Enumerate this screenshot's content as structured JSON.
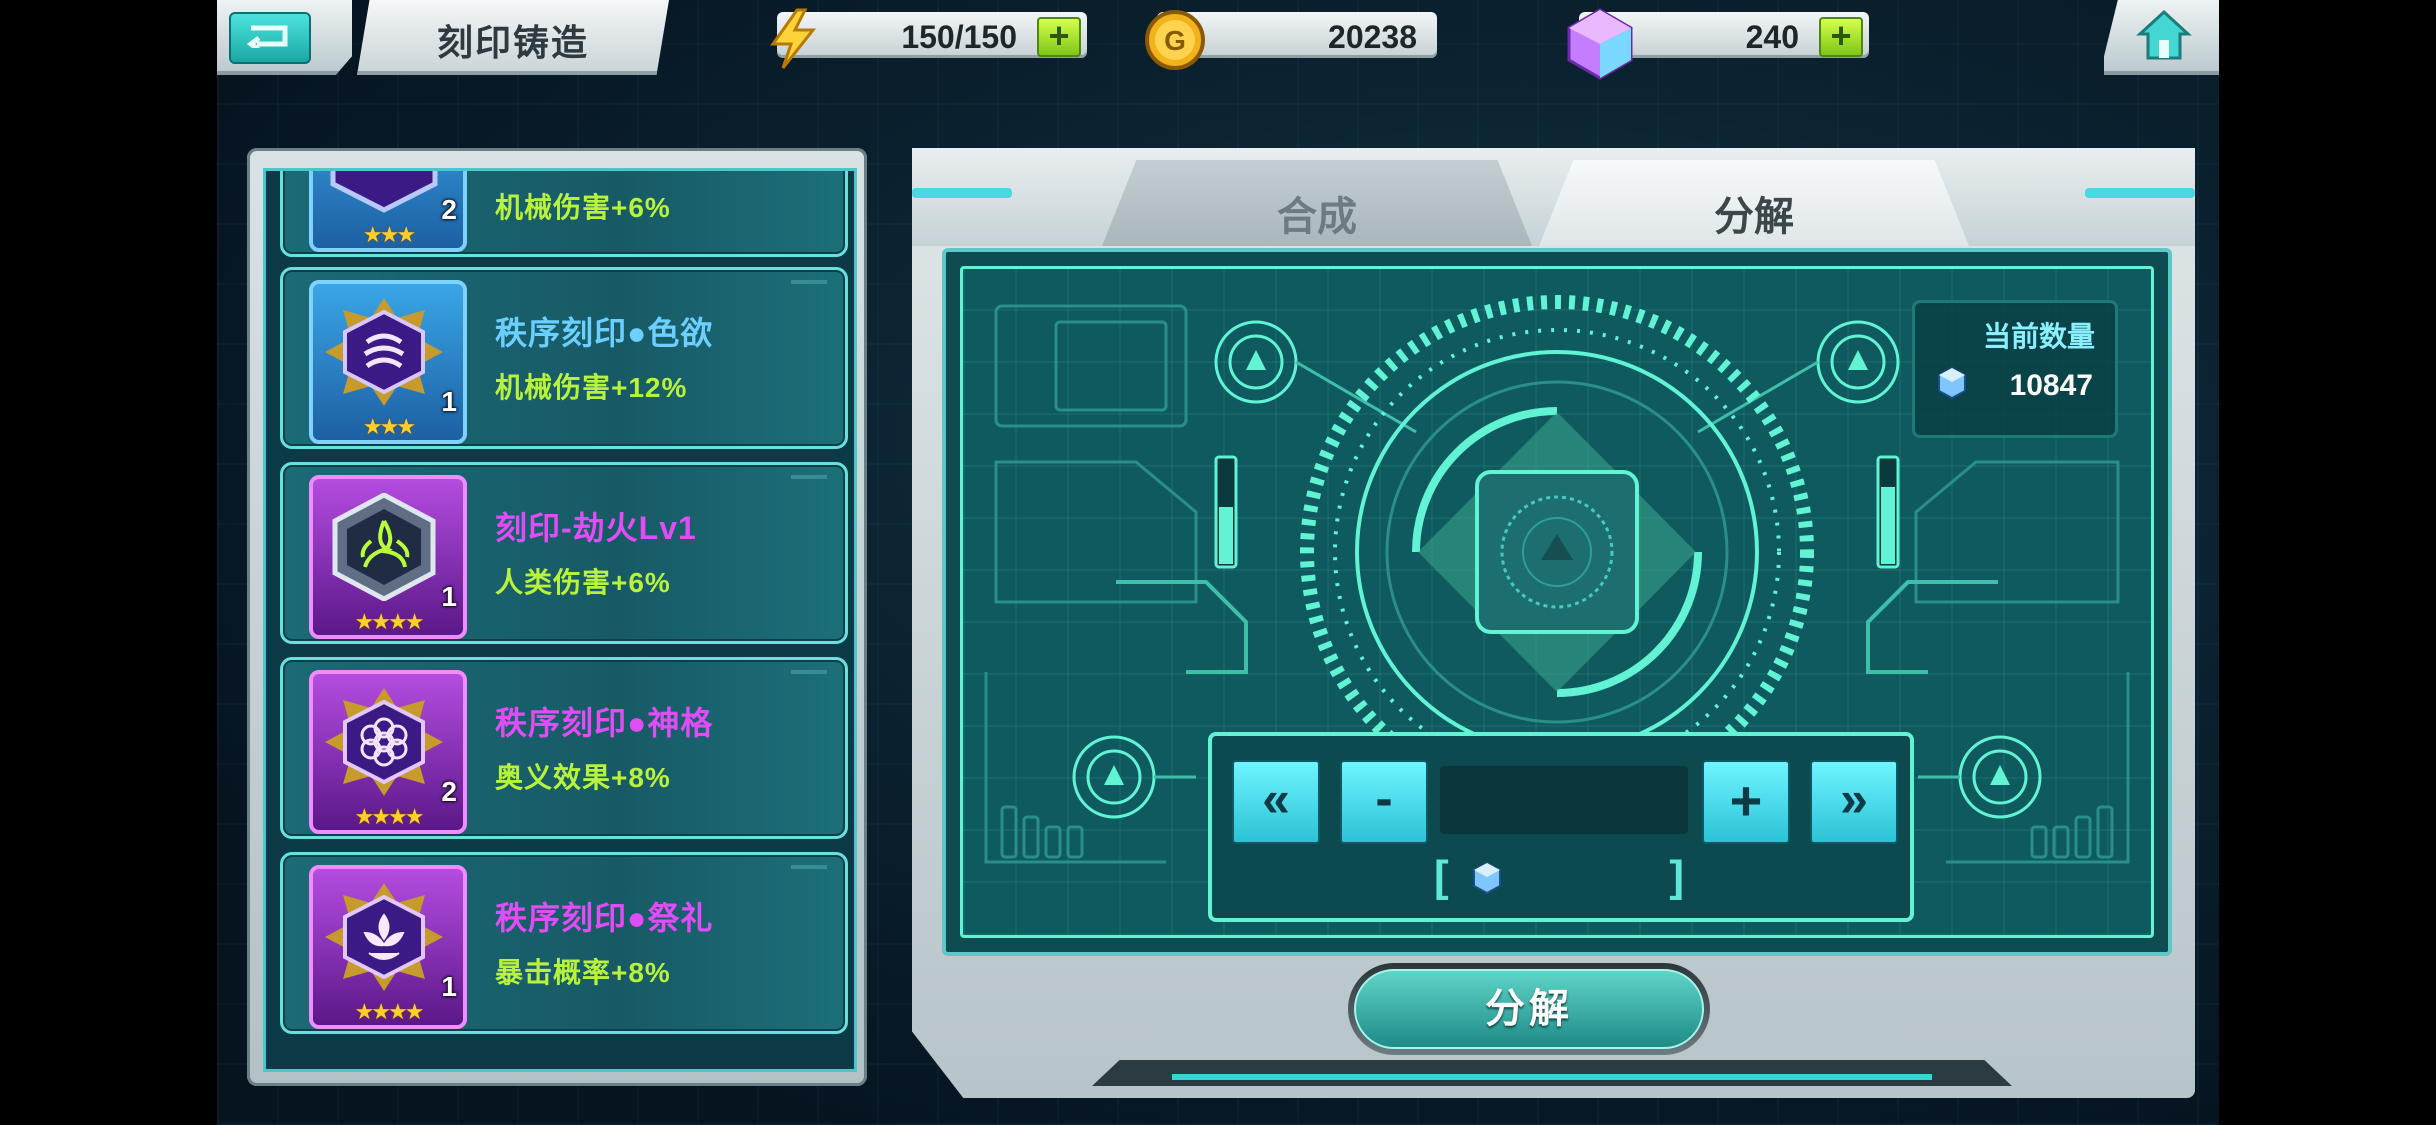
{
  "header": {
    "title": "刻印铸造",
    "energy": "150/150",
    "gold": "20238",
    "gems": "240"
  },
  "list_items": [
    {
      "name": "",
      "effect": "机械伤害+6%",
      "count": "2",
      "stars": "★★★",
      "rarity": "blue"
    },
    {
      "name": "秩序刻印●色欲",
      "effect": "机械伤害+12%",
      "count": "1",
      "stars": "★★★",
      "rarity": "blue"
    },
    {
      "name": "刻印-劫火Lv1",
      "effect": "人类伤害+6%",
      "count": "1",
      "stars": "★★★★",
      "rarity": "purple"
    },
    {
      "name": "秩序刻印●神格",
      "effect": "奥义效果+8%",
      "count": "2",
      "stars": "★★★★",
      "rarity": "purple"
    },
    {
      "name": "秩序刻印●祭礼",
      "effect": "暴击概率+8%",
      "count": "1",
      "stars": "★★★★",
      "rarity": "purple"
    }
  ],
  "tabs": [
    "合成",
    "分解"
  ],
  "active_tab": "分解",
  "current_count": {
    "label": "当前数量",
    "value": "10847"
  },
  "controls": {
    "first": "«",
    "minus": "-",
    "plus": "+",
    "last": "»",
    "quantity": ""
  },
  "decompose_button": "分解",
  "colors": {
    "accent": "#61f3d4",
    "blue_rarity": "#6ccfff",
    "purple_rarity": "#e04cf5",
    "effect_text": "#b9f23c"
  }
}
